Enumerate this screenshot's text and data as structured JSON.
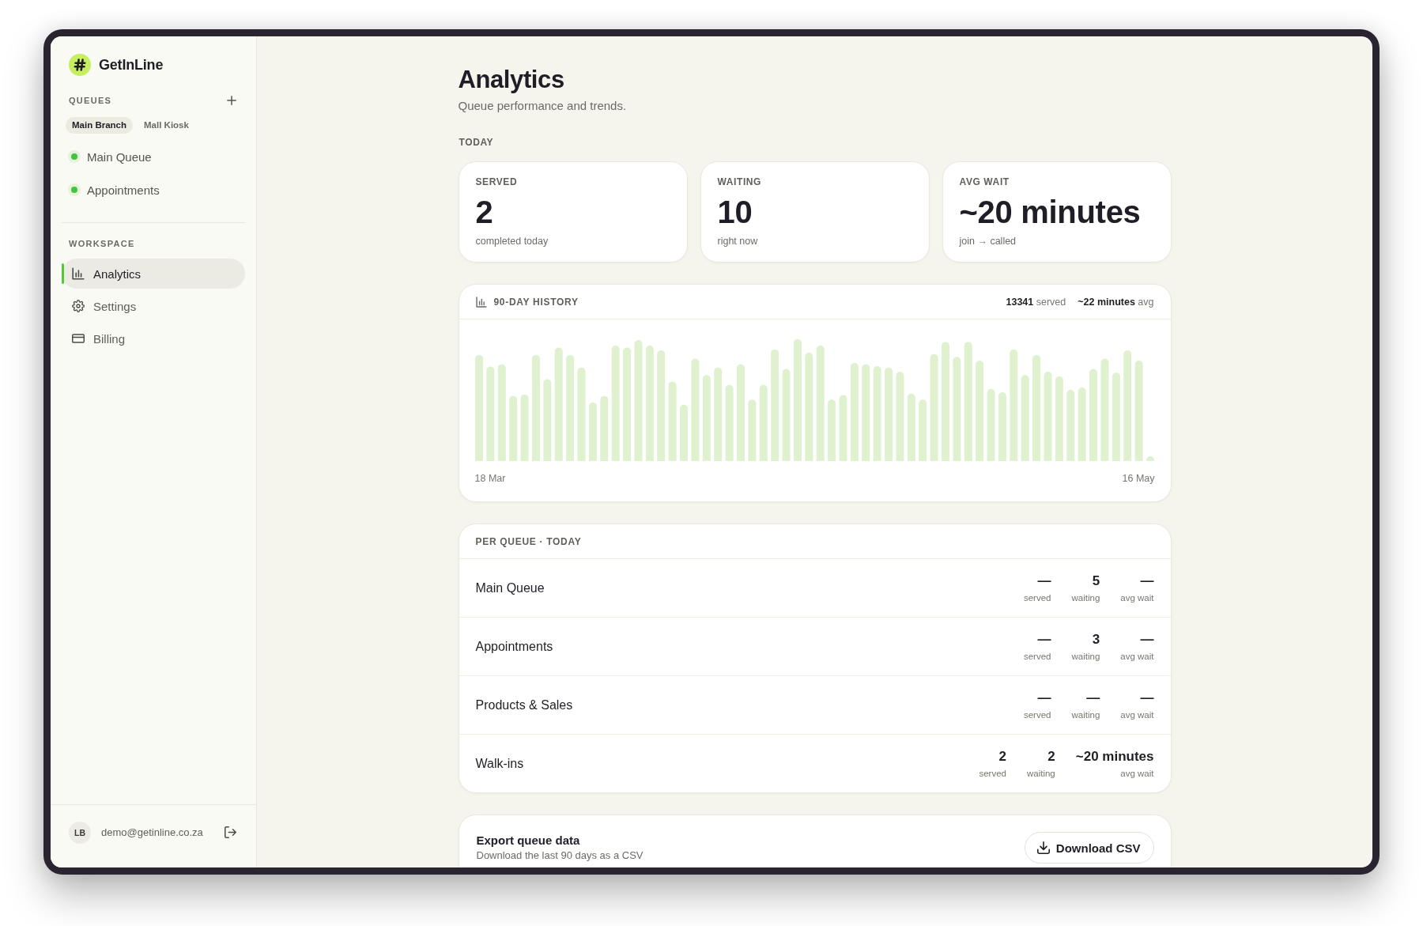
{
  "app": {
    "name": "GetInLine"
  },
  "sidebar": {
    "queues_heading": "QUEUES",
    "branches": [
      {
        "label": "Main Branch",
        "selected": true
      },
      {
        "label": "Mall Kiosk",
        "selected": false
      }
    ],
    "queues": [
      {
        "name": "Main Queue",
        "active": true
      },
      {
        "name": "Appointments",
        "active": true
      }
    ],
    "workspace_heading": "WORKSPACE",
    "nav": [
      {
        "label": "Analytics",
        "selected": true
      },
      {
        "label": "Settings",
        "selected": false
      },
      {
        "label": "Billing",
        "selected": false
      }
    ],
    "user": {
      "initials": "LB",
      "email": "demo@getinline.co.za"
    }
  },
  "page": {
    "title": "Analytics",
    "subtitle": "Queue performance and trends."
  },
  "today": {
    "heading": "TODAY",
    "stats": [
      {
        "label": "SERVED",
        "value": "2",
        "caption": "completed today"
      },
      {
        "label": "WAITING",
        "value": "10",
        "caption": "right now"
      },
      {
        "label": "AVG WAIT",
        "value": "~20 minutes",
        "caption": "join → called"
      }
    ]
  },
  "history": {
    "title": "90-DAY HISTORY",
    "summary": [
      "**13341** served",
      "**~22 minutes** avg"
    ],
    "start_label": "18 Mar",
    "end_label": "16 May"
  },
  "per_queue": {
    "title": "PER QUEUE · TODAY",
    "rows": [
      {
        "name": "Main Queue",
        "stats": [
          {
            "value": "—",
            "label": "served"
          },
          {
            "value": "5",
            "label": "waiting"
          },
          {
            "value": "—",
            "label": "avg wait"
          }
        ]
      },
      {
        "name": "Appointments",
        "stats": [
          {
            "value": "—",
            "label": "served"
          },
          {
            "value": "3",
            "label": "waiting"
          },
          {
            "value": "—",
            "label": "avg wait"
          }
        ]
      },
      {
        "name": "Products & Sales",
        "stats": [
          {
            "value": "—",
            "label": "served"
          },
          {
            "value": "—",
            "label": "waiting"
          },
          {
            "value": "—",
            "label": "avg wait"
          }
        ]
      },
      {
        "name": "Walk-ins",
        "stats": [
          {
            "value": "2",
            "label": "served"
          },
          {
            "value": "2",
            "label": "waiting"
          },
          {
            "value": "~20 minutes",
            "label": "avg wait"
          }
        ]
      }
    ]
  },
  "export": {
    "title": "Export queue data",
    "subtitle": "Download the last 90 days as a CSV",
    "button": "Download CSV"
  }
}
